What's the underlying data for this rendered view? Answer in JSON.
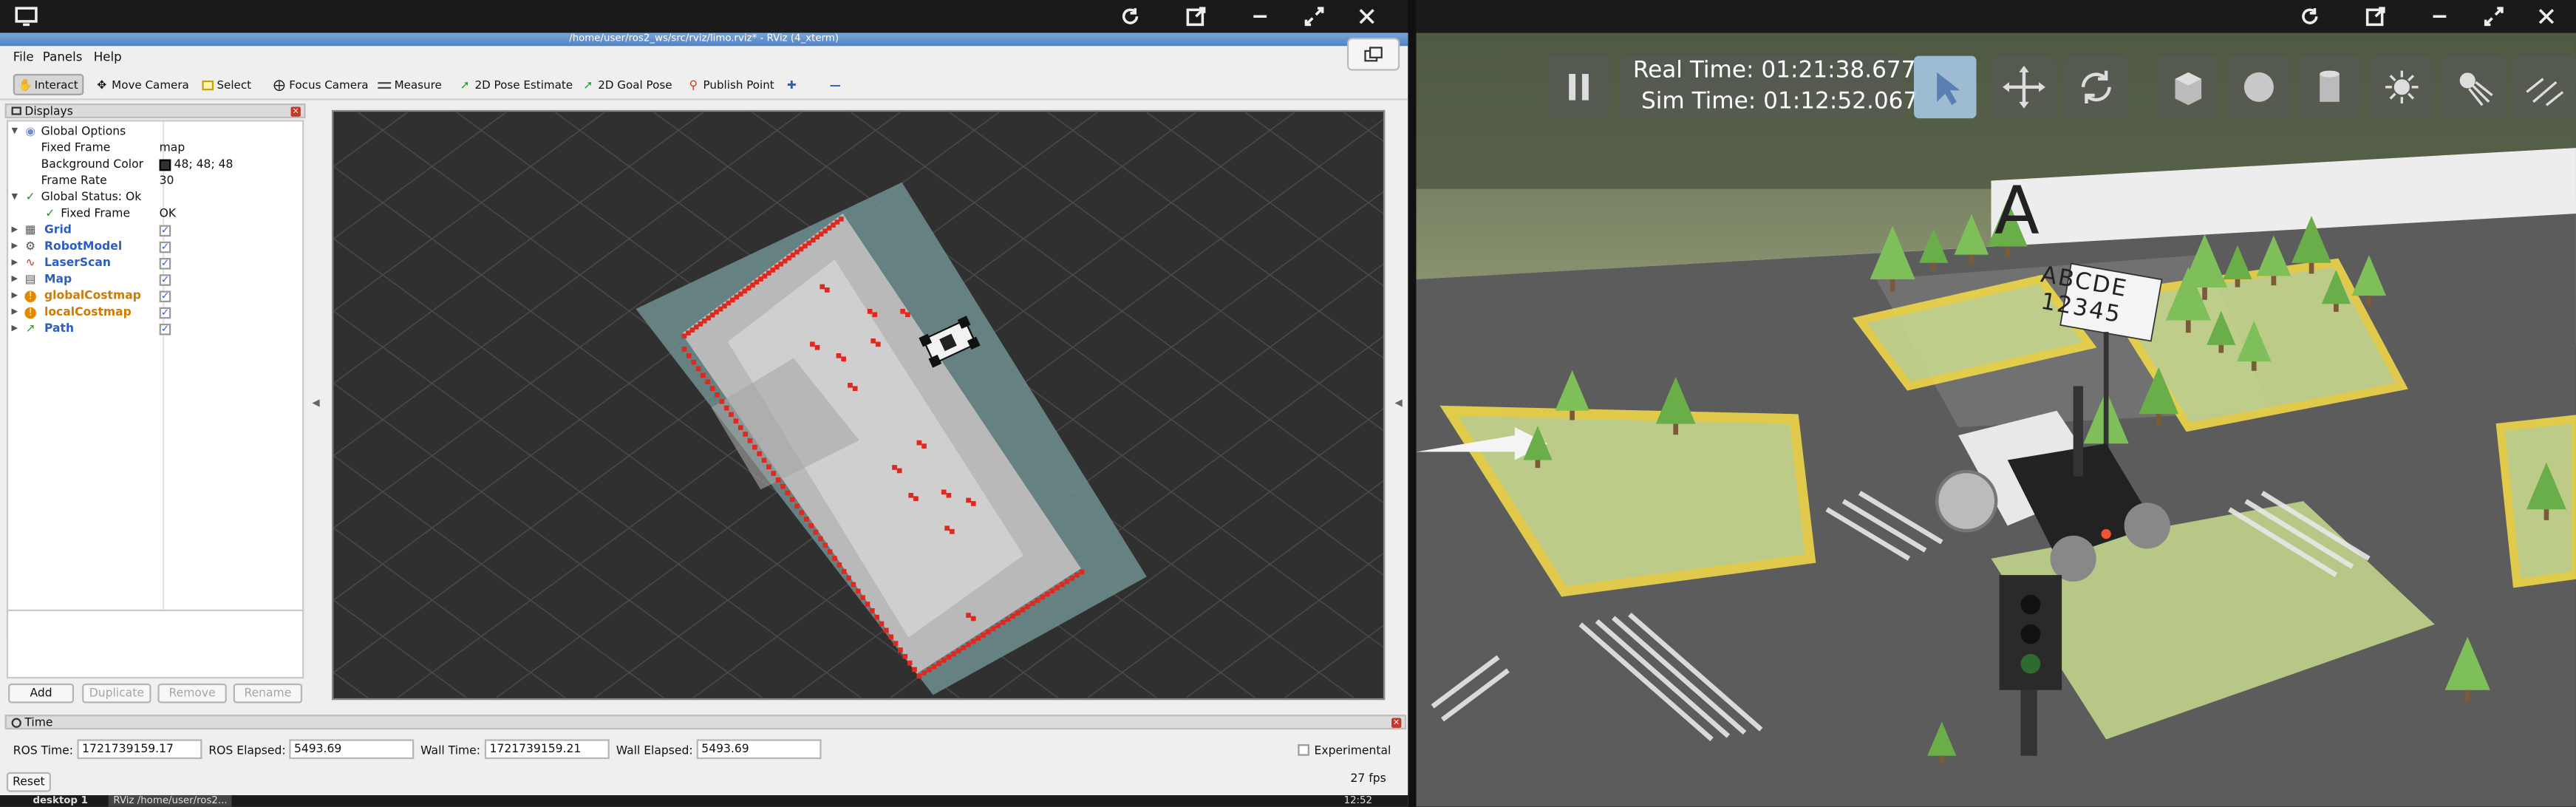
{
  "rviz_window": {
    "title": "/home/user/ros2_ws/src/rviz/limo.rviz* - RViz (4_xterm)",
    "menus": [
      "File",
      "Panels",
      "Help"
    ],
    "tools": [
      "Interact",
      "Move Camera",
      "Select",
      "Focus Camera",
      "Measure",
      "2D Pose Estimate",
      "2D Goal Pose",
      "Publish Point"
    ],
    "displays_panel": {
      "title": "Displays",
      "global_options": "Global Options",
      "fixed_frame_label": "Fixed Frame",
      "fixed_frame_value": "map",
      "background_color_label": "Background Color",
      "background_color_value": "48; 48; 48",
      "frame_rate_label": "Frame Rate",
      "frame_rate_value": "30",
      "global_status": "Global Status: Ok",
      "status_fixed_frame_label": "Fixed Frame",
      "status_fixed_frame_value": "OK",
      "items": [
        "Grid",
        "RobotModel",
        "LaserScan",
        "Map",
        "globalCostmap",
        "localCostmap",
        "Path"
      ],
      "buttons": {
        "add": "Add",
        "duplicate": "Duplicate",
        "remove": "Remove",
        "rename": "Rename"
      }
    },
    "time_panel": {
      "title": "Time",
      "ros_time_label": "ROS Time:",
      "ros_time_value": "1721739159.17",
      "ros_elapsed_label": "ROS Elapsed:",
      "ros_elapsed_value": "5493.69",
      "wall_time_label": "Wall Time:",
      "wall_time_value": "1721739159.21",
      "wall_elapsed_label": "Wall Elapsed:",
      "wall_elapsed_value": "5493.69",
      "experimental_label": "Experimental",
      "reset_label": "Reset",
      "fps": "27 fps"
    },
    "taskbar": {
      "desktop": "desktop 1",
      "task": "RViz /home/user/ros2...",
      "clock": "12:52"
    }
  },
  "gazebo": {
    "real_time_label": "Real Time:",
    "real_time_value": "01:21:38.677",
    "sim_time_label": "Sim Time:",
    "sim_time_value": "01:12:52.067",
    "sign_letter": "A",
    "sign_row1": "ABCDE",
    "sign_row2": "12345"
  },
  "colors": {
    "rviz_bg": "#303030",
    "costmap": "#6f8f8f",
    "obstacles": "#e0281e",
    "accent_blue": "#2b5fc3",
    "accent_orange": "#d07a00"
  }
}
